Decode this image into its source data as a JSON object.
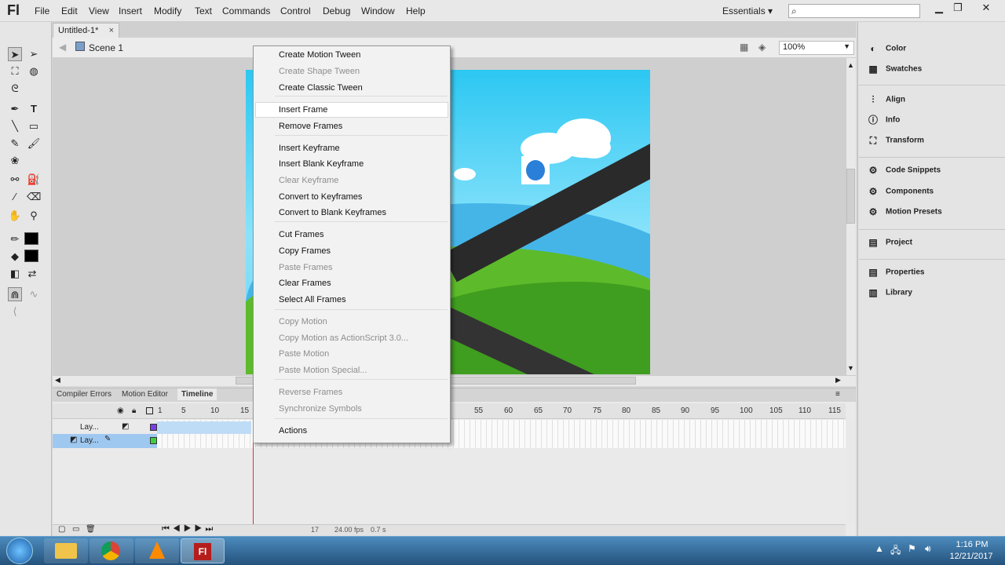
{
  "app": {
    "logo": "Fl"
  },
  "menubar": {
    "items": [
      "File",
      "Edit",
      "View",
      "Insert",
      "Modify",
      "Text",
      "Commands",
      "Control",
      "Debug",
      "Window",
      "Help"
    ],
    "workspace": "Essentials",
    "window_controls": [
      "minimize-icon",
      "restore-icon",
      "close-icon"
    ]
  },
  "document": {
    "tab_title": "Untitled-1*",
    "scene": "Scene 1",
    "zoom": "100%"
  },
  "right_panel": {
    "items": [
      "Color",
      "Swatches",
      "Align",
      "Info",
      "Transform",
      "Code Snippets",
      "Components",
      "Motion Presets",
      "Project",
      "Properties",
      "Library"
    ]
  },
  "bottom_panel": {
    "tabs": [
      "Compiler Errors",
      "Motion Editor",
      "Timeline"
    ]
  },
  "timeline": {
    "ruler": [
      "1",
      "5",
      "10",
      "15",
      "55",
      "60",
      "65",
      "70",
      "75",
      "80",
      "85",
      "90",
      "95",
      "100",
      "105",
      "110",
      "115"
    ],
    "layers": [
      "Lay...",
      "Lay..."
    ],
    "current_frame": "17",
    "fps": "24.00 fps",
    "elapsed": "0.7 s"
  },
  "context_menu": {
    "groups": [
      [
        {
          "label": "Create Motion Tween",
          "enabled": true
        },
        {
          "label": "Create Shape Tween",
          "enabled": false
        },
        {
          "label": "Create Classic Tween",
          "enabled": true
        }
      ],
      [
        {
          "label": "Insert Frame",
          "enabled": true,
          "highlighted": true
        },
        {
          "label": "Remove Frames",
          "enabled": true
        }
      ],
      [
        {
          "label": "Insert Keyframe",
          "enabled": true
        },
        {
          "label": "Insert Blank Keyframe",
          "enabled": true
        },
        {
          "label": "Clear Keyframe",
          "enabled": false
        },
        {
          "label": "Convert to Keyframes",
          "enabled": true
        },
        {
          "label": "Convert to Blank Keyframes",
          "enabled": true
        }
      ],
      [
        {
          "label": "Cut Frames",
          "enabled": true
        },
        {
          "label": "Copy Frames",
          "enabled": true
        },
        {
          "label": "Paste Frames",
          "enabled": false
        },
        {
          "label": "Clear Frames",
          "enabled": true
        },
        {
          "label": "Select All Frames",
          "enabled": true
        }
      ],
      [
        {
          "label": "Copy Motion",
          "enabled": false
        },
        {
          "label": "Copy Motion as ActionScript 3.0...",
          "enabled": false
        },
        {
          "label": "Paste Motion",
          "enabled": false
        },
        {
          "label": "Paste Motion Special...",
          "enabled": false
        }
      ],
      [
        {
          "label": "Reverse Frames",
          "enabled": false
        },
        {
          "label": "Synchronize Symbols",
          "enabled": false
        }
      ],
      [
        {
          "label": "Actions",
          "enabled": true
        }
      ]
    ]
  },
  "taskbar": {
    "time": "1:16 PM",
    "date": "12/21/2017"
  },
  "colors": {
    "highlight": "#ffffff",
    "disabled_text": "#8e8e8e",
    "sky": "#2cc7f2",
    "grass": "#5dbb2b",
    "playhead": "#e03030"
  }
}
